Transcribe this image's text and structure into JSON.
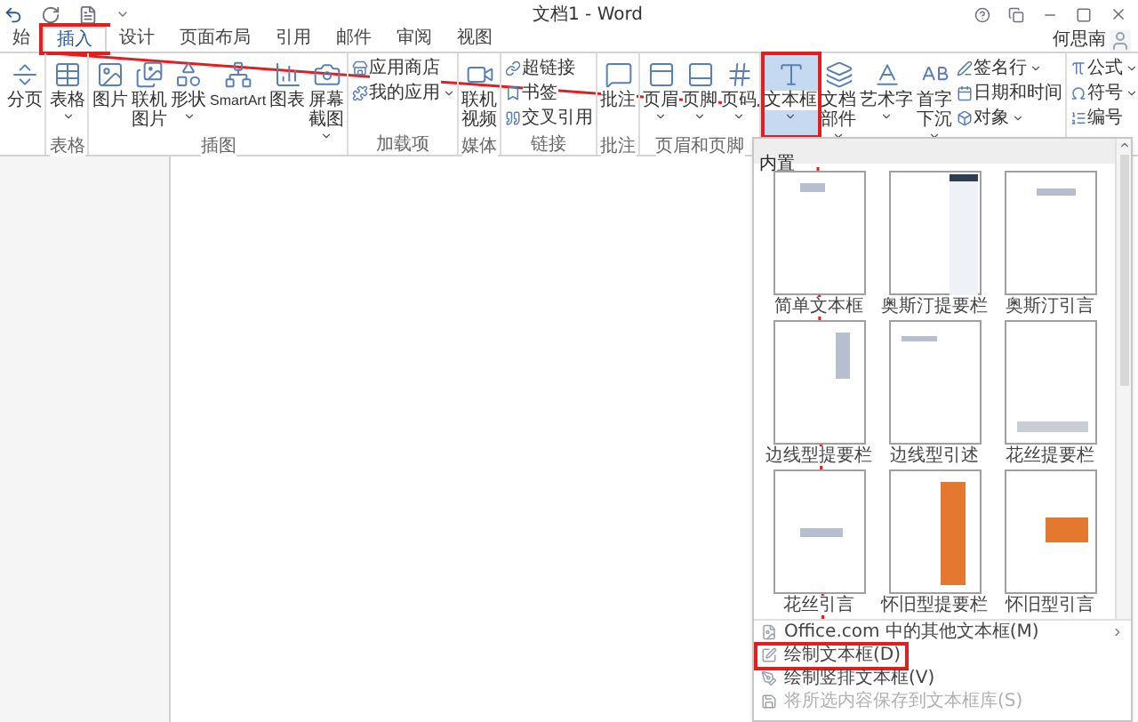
{
  "window": {
    "title": "文档1 - Word",
    "user": "何思南"
  },
  "tabs": [
    {
      "label": "始",
      "selected": false,
      "annotated": false
    },
    {
      "label": "插入",
      "selected": true,
      "annotated": true
    },
    {
      "label": "设计",
      "selected": false,
      "annotated": false
    },
    {
      "label": "页面布局",
      "selected": false,
      "annotated": false
    },
    {
      "label": "引用",
      "selected": false,
      "annotated": false
    },
    {
      "label": "邮件",
      "selected": false,
      "annotated": false
    },
    {
      "label": "审阅",
      "selected": false,
      "annotated": false
    },
    {
      "label": "视图",
      "selected": false,
      "annotated": false
    }
  ],
  "ribbon": {
    "groups": [
      {
        "items": [
          {
            "kind": "large",
            "label": "分页",
            "caret": false,
            "selected": false
          }
        ]
      },
      {
        "label": "表格",
        "items": [
          {
            "kind": "large",
            "label": "表格",
            "caret": true,
            "selected": false
          }
        ]
      },
      {
        "label": "插图",
        "items": [
          {
            "kind": "large",
            "label": "图片",
            "caret": false,
            "selected": false
          },
          {
            "kind": "large",
            "label": "联机图片",
            "caret": false,
            "selected": false
          },
          {
            "kind": "large",
            "label": "形状",
            "caret": true,
            "selected": false
          },
          {
            "kind": "large",
            "label": "SmartArt",
            "caret": false,
            "selected": false
          },
          {
            "kind": "large",
            "label": "图表",
            "caret": false,
            "selected": false
          },
          {
            "kind": "large",
            "label": "屏幕截图",
            "caret": true,
            "selected": false
          }
        ]
      },
      {
        "label": "加载项",
        "items": [
          {
            "kind": "small",
            "label": "应用商店",
            "caret": false,
            "selected": false
          },
          {
            "kind": "small",
            "label": "我的应用",
            "caret": true,
            "selected": false
          }
        ]
      },
      {
        "label": "媒体",
        "items": [
          {
            "kind": "large",
            "label": "联机视频",
            "caret": false,
            "selected": false
          }
        ]
      },
      {
        "label": "链接",
        "items": [
          {
            "kind": "small",
            "label": "超链接",
            "caret": false,
            "selected": false
          },
          {
            "kind": "small",
            "label": "书签",
            "caret": false,
            "selected": false
          },
          {
            "kind": "small",
            "label": "交叉引用",
            "caret": false,
            "selected": false
          }
        ]
      },
      {
        "label": "批注",
        "items": [
          {
            "kind": "large",
            "label": "批注",
            "caret": false,
            "selected": false
          }
        ]
      },
      {
        "label": "页眉和页脚",
        "items": [
          {
            "kind": "large",
            "label": "页眉",
            "caret": true,
            "selected": false
          },
          {
            "kind": "large",
            "label": "页脚",
            "caret": true,
            "selected": false
          },
          {
            "kind": "large",
            "label": "页码",
            "caret": true,
            "selected": false
          }
        ]
      },
      {
        "items": [
          {
            "kind": "large",
            "label": "文本框",
            "caret": true,
            "selected": true
          },
          {
            "kind": "large",
            "label": "文档部件",
            "caret": true,
            "selected": false
          },
          {
            "kind": "large",
            "label": "艺术字",
            "caret": true,
            "selected": false
          },
          {
            "kind": "large",
            "label": "首字下沉",
            "caret": true,
            "selected": false
          },
          {
            "kind": "small",
            "label": "签名行",
            "caret": true,
            "selected": false
          },
          {
            "kind": "small",
            "label": "日期和时间",
            "caret": false,
            "selected": false
          },
          {
            "kind": "small",
            "label": "对象",
            "caret": true,
            "selected": false
          }
        ]
      },
      {
        "items": [
          {
            "kind": "small",
            "label": "公式",
            "caret": true,
            "selected": false
          },
          {
            "kind": "small",
            "label": "符号",
            "caret": true,
            "selected": false
          },
          {
            "kind": "small",
            "label": "编号",
            "caret": false,
            "selected": false
          }
        ]
      }
    ]
  },
  "dropdown": {
    "header": "内置",
    "gallery": [
      {
        "label": "简单文本框"
      },
      {
        "label": "奥斯汀提要栏"
      },
      {
        "label": "奥斯汀引言"
      },
      {
        "label": "边线型提要栏"
      },
      {
        "label": "边线型引述"
      },
      {
        "label": "花丝提要栏"
      },
      {
        "label": "花丝引言"
      },
      {
        "label": "怀旧型提要栏"
      },
      {
        "label": "怀旧型引言"
      }
    ],
    "menu": [
      {
        "label": "Office.com 中的其他文本框(M)",
        "disabled": false,
        "annotated": false,
        "submenu": true
      },
      {
        "label": "绘制文本框(D)",
        "disabled": false,
        "annotated": true,
        "submenu": false
      },
      {
        "label": "绘制竖排文本框(V)",
        "disabled": false,
        "annotated": false,
        "submenu": false
      },
      {
        "label": "将所选内容保存到文本框库(S)",
        "disabled": true,
        "annotated": false,
        "submenu": false
      }
    ]
  }
}
